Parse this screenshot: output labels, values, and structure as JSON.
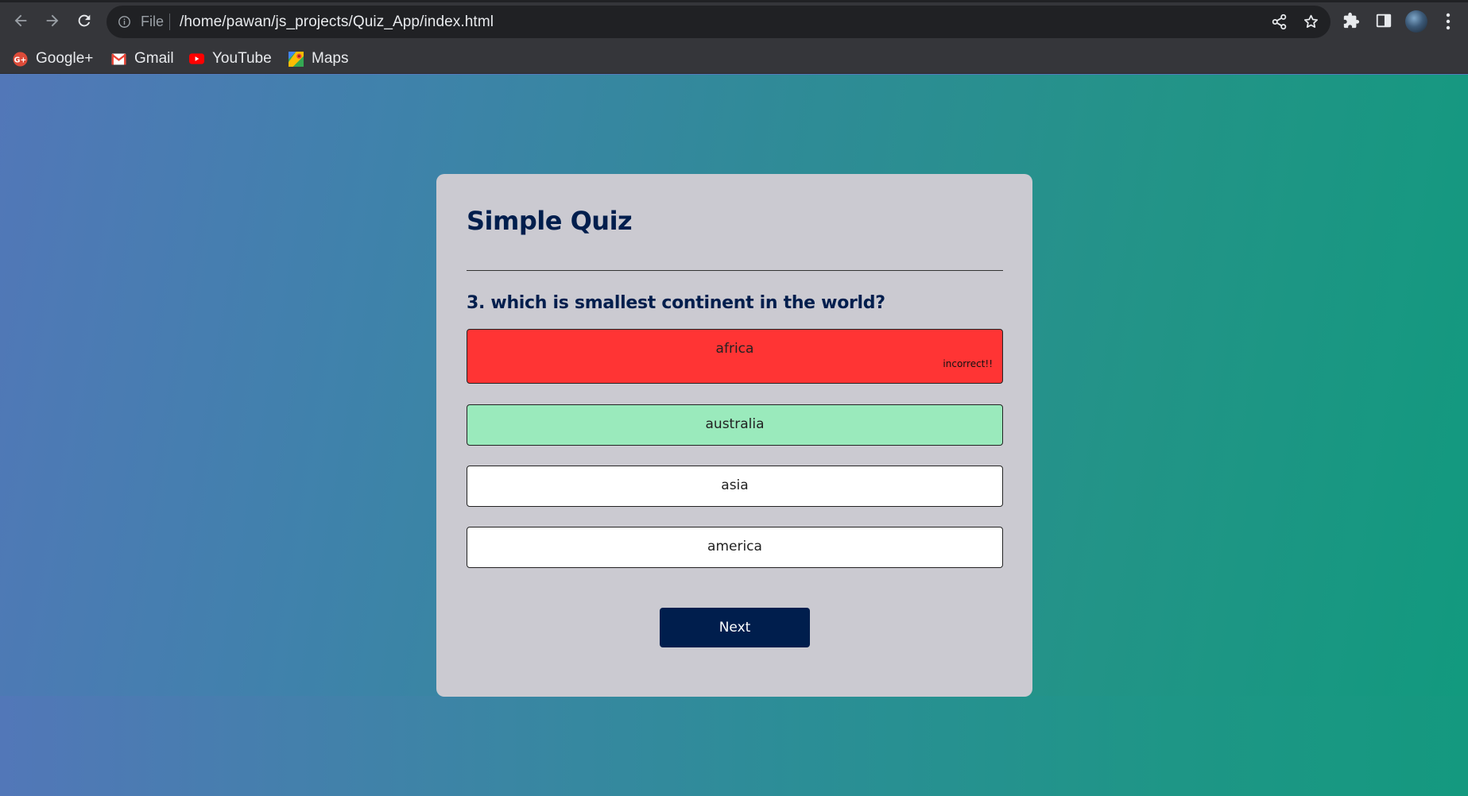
{
  "browser": {
    "url_scheme": "File",
    "url": "/home/pawan/js_projects/Quiz_App/index.html",
    "bookmarks": [
      {
        "label": "Google+",
        "icon": "google-plus-icon",
        "color": "#dd4b39"
      },
      {
        "label": "Gmail",
        "icon": "gmail-icon",
        "color": "#ea4335"
      },
      {
        "label": "YouTube",
        "icon": "youtube-icon",
        "color": "#ff0000"
      },
      {
        "label": "Maps",
        "icon": "maps-icon",
        "color": "#34a853"
      }
    ]
  },
  "quiz": {
    "title": "Simple Quiz",
    "question": "3. which is smallest continent in the world?",
    "answers": [
      {
        "text": "africa",
        "state": "incorrect",
        "status_text": "incorrect!!",
        "color": "#ff3434"
      },
      {
        "text": "australia",
        "state": "correct",
        "color": "#9aeabc"
      },
      {
        "text": "asia",
        "state": "neutral",
        "color": "#ffffff"
      },
      {
        "text": "america",
        "state": "neutral",
        "color": "#ffffff"
      }
    ],
    "next_label": "Next"
  },
  "colors": {
    "accent": "#001e4d",
    "card_background": "#cbcad1",
    "gradient_start": "#5277b8",
    "gradient_end": "#119a7e"
  }
}
